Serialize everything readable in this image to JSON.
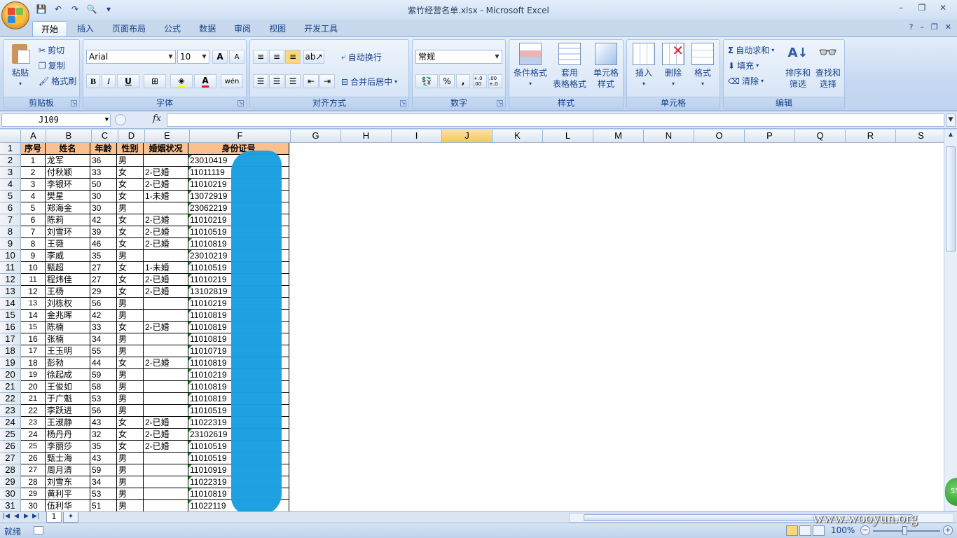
{
  "window": {
    "title": "紫竹经营名单.xlsx - Microsoft Excel",
    "minimize": "–",
    "restore": "❐",
    "close": "✕"
  },
  "tabs": [
    "开始",
    "插入",
    "页面布局",
    "公式",
    "数据",
    "审阅",
    "视图",
    "开发工具"
  ],
  "active_tab": "开始",
  "help_controls": [
    "?",
    "–",
    "❐",
    "✕"
  ],
  "ribbon": {
    "clipboard": {
      "label": "剪贴板",
      "paste": "粘贴",
      "cut": "剪切",
      "copy": "复制",
      "format_painter": "格式刷"
    },
    "font": {
      "label": "字体",
      "font_name": "Arial",
      "font_size": "10",
      "bold": "B",
      "italic": "I",
      "underline": "U",
      "grow": "A",
      "shrink": "A"
    },
    "alignment": {
      "label": "对齐方式",
      "wrap": "自动换行",
      "merge": "合并后居中"
    },
    "number": {
      "label": "数字",
      "format": "常规",
      "percent": "%",
      "comma": ",",
      "inc": "+.0 .00",
      "dec": ".00 +.0"
    },
    "styles": {
      "label": "样式",
      "cond": "条件格式",
      "table_l1": "套用",
      "table_l2": "表格格式",
      "cell_l1": "单元格",
      "cell_l2": "样式"
    },
    "cells": {
      "label": "单元格",
      "insert": "插入",
      "delete": "删除",
      "format": "格式"
    },
    "editing": {
      "label": "编辑",
      "autosum": "自动求和",
      "fill": "填充",
      "clear": "清除",
      "sort_l1": "排序和",
      "sort_l2": "筛选",
      "find_l1": "查找和",
      "find_l2": "选择"
    }
  },
  "formula_bar": {
    "name_box": "J109",
    "fx": "fx",
    "value": ""
  },
  "columns": [
    "A",
    "B",
    "C",
    "D",
    "E",
    "F",
    "G",
    "H",
    "I",
    "J",
    "K",
    "L",
    "M",
    "N",
    "O",
    "P",
    "Q",
    "R",
    "S"
  ],
  "selected_column": "J",
  "header_row": {
    "a": "序号",
    "b": "姓名",
    "c": "年龄",
    "d": "性别",
    "e": "婚姻状况",
    "f": "身份证号"
  },
  "rows": [
    {
      "n": "2",
      "a": "1",
      "b": "龙军",
      "c": "36",
      "d": "男",
      "e": "",
      "f": "23010419"
    },
    {
      "n": "3",
      "a": "2",
      "b": "付秋颖",
      "c": "33",
      "d": "女",
      "e": "2-已婚",
      "f": "11011119"
    },
    {
      "n": "4",
      "a": "3",
      "b": "李银环",
      "c": "50",
      "d": "女",
      "e": "2-已婚",
      "f": "11010219"
    },
    {
      "n": "5",
      "a": "4",
      "b": "樊星",
      "c": "30",
      "d": "女",
      "e": "1-未婚",
      "f": "13072919"
    },
    {
      "n": "6",
      "a": "5",
      "b": "郑海金",
      "c": "30",
      "d": "男",
      "e": "",
      "f": "23062219"
    },
    {
      "n": "7",
      "a": "6",
      "b": "陈莉",
      "c": "42",
      "d": "女",
      "e": "2-已婚",
      "f": "11010219"
    },
    {
      "n": "8",
      "a": "7",
      "b": "刘雪环",
      "c": "39",
      "d": "女",
      "e": "2-已婚",
      "f": "11010519"
    },
    {
      "n": "9",
      "a": "8",
      "b": "王薇",
      "c": "46",
      "d": "女",
      "e": "2-已婚",
      "f": "11010819"
    },
    {
      "n": "10",
      "a": "9",
      "b": "李威",
      "c": "35",
      "d": "男",
      "e": "",
      "f": "23010219"
    },
    {
      "n": "11",
      "a": "10",
      "b": "甄超",
      "c": "27",
      "d": "女",
      "e": "1-未婚",
      "f": "11010519"
    },
    {
      "n": "12",
      "a": "11",
      "b": "程炜佳",
      "c": "27",
      "d": "女",
      "e": "2-已婚",
      "f": "11010219"
    },
    {
      "n": "13",
      "a": "12",
      "b": "王杨",
      "c": "29",
      "d": "女",
      "e": "2-已婚",
      "f": "13102819"
    },
    {
      "n": "14",
      "a": "13",
      "b": "刘栋权",
      "c": "56",
      "d": "男",
      "e": "",
      "f": "11010219"
    },
    {
      "n": "15",
      "a": "14",
      "b": "金兆晖",
      "c": "42",
      "d": "男",
      "e": "",
      "f": "11010819"
    },
    {
      "n": "16",
      "a": "15",
      "b": "陈楠",
      "c": "33",
      "d": "女",
      "e": "2-已婚",
      "f": "11010819"
    },
    {
      "n": "17",
      "a": "16",
      "b": "张楠",
      "c": "34",
      "d": "男",
      "e": "",
      "f": "11010819"
    },
    {
      "n": "18",
      "a": "17",
      "b": "王玉明",
      "c": "55",
      "d": "男",
      "e": "",
      "f": "11010719"
    },
    {
      "n": "19",
      "a": "18",
      "b": "彭勃",
      "c": "44",
      "d": "女",
      "e": "2-已婚",
      "f": "11010819"
    },
    {
      "n": "20",
      "a": "19",
      "b": "徐起成",
      "c": "59",
      "d": "男",
      "e": "",
      "f": "11010219"
    },
    {
      "n": "21",
      "a": "20",
      "b": "王俊如",
      "c": "58",
      "d": "男",
      "e": "",
      "f": "11010819"
    },
    {
      "n": "22",
      "a": "21",
      "b": "于广魁",
      "c": "53",
      "d": "男",
      "e": "",
      "f": "11010819"
    },
    {
      "n": "23",
      "a": "22",
      "b": "李跃进",
      "c": "56",
      "d": "男",
      "e": "",
      "f": "11010519"
    },
    {
      "n": "24",
      "a": "23",
      "b": "王淑静",
      "c": "43",
      "d": "女",
      "e": "2-已婚",
      "f": "11022319"
    },
    {
      "n": "25",
      "a": "24",
      "b": "杨丹丹",
      "c": "32",
      "d": "女",
      "e": "2-已婚",
      "f": "23102619"
    },
    {
      "n": "26",
      "a": "25",
      "b": "李丽莎",
      "c": "35",
      "d": "女",
      "e": "2-已婚",
      "f": "11010519"
    },
    {
      "n": "27",
      "a": "26",
      "b": "甄士海",
      "c": "43",
      "d": "男",
      "e": "",
      "f": "11010519"
    },
    {
      "n": "28",
      "a": "27",
      "b": "周月清",
      "c": "59",
      "d": "男",
      "e": "",
      "f": "11010919"
    },
    {
      "n": "29",
      "a": "28",
      "b": "刘雪东",
      "c": "34",
      "d": "男",
      "e": "",
      "f": "11022319"
    },
    {
      "n": "30",
      "a": "29",
      "b": "黄利平",
      "c": "53",
      "d": "男",
      "e": "",
      "f": "11010819"
    },
    {
      "n": "31",
      "a": "30",
      "b": "伍利华",
      "c": "51",
      "d": "男",
      "e": "",
      "f": "11022119"
    }
  ],
  "sheet_tab": "1",
  "status": {
    "ready": "就绪",
    "zoom": "100%",
    "minus": "−",
    "plus": "+"
  },
  "watermark": "www.wooyun.org",
  "badge": "55",
  "colors": {
    "header_fill": "#fac090",
    "redaction": "#1b9fe0",
    "selected_col": "#f7c659"
  }
}
